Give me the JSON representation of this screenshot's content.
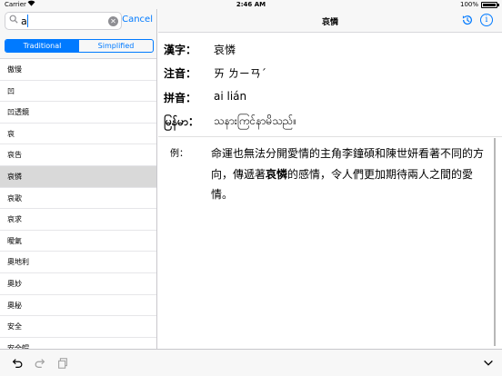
{
  "status_bar": {
    "carrier": "Carrier",
    "time": "2:46 AM",
    "battery_pct": "100%",
    "battery_level": 1.0
  },
  "search": {
    "value": "a",
    "cancel_label": "Cancel"
  },
  "segments": [
    "Traditional",
    "Simplified"
  ],
  "selected_segment": "Traditional",
  "word_list": [
    "傲慢",
    "凹",
    "凹透鏡",
    "哀",
    "哀告",
    "哀憐",
    "哀歌",
    "哀求",
    "曖氣",
    "奧地利",
    "奧妙",
    "奧秘",
    "安全",
    "安全帽"
  ],
  "selected_word": "哀憐",
  "nav": {
    "title": "哀憐"
  },
  "entry": {
    "hanzi_label": "漢字：",
    "hanzi": "哀憐",
    "zhuyin_label": "注音：",
    "zhuyin": "ㄞ ㄌㄧㄢˊ",
    "pinyin_label": "拼音：",
    "pinyin": "ai lián",
    "burmese_label": "မြန်မာ：",
    "burmese": "သနားကြင်နာမိသည်။",
    "example_label": "例：",
    "example_before": "命運也無法分開愛情的主角李鐘碩和陳世妍看著不同的方向，傳遞著",
    "example_bold": "哀憐",
    "example_after": "的感情，令人們更加期待兩人之間的愛情。"
  },
  "colors": {
    "accent": "#007aff",
    "bar_bg": "#f7f7f7",
    "selection": "#d9d9d9"
  },
  "icons": [
    "search-icon",
    "clear-icon",
    "history-icon",
    "info-icon",
    "undo-icon",
    "redo-icon",
    "paste-icon",
    "keyboard-dismiss-icon",
    "wifi-icon",
    "battery-icon"
  ]
}
